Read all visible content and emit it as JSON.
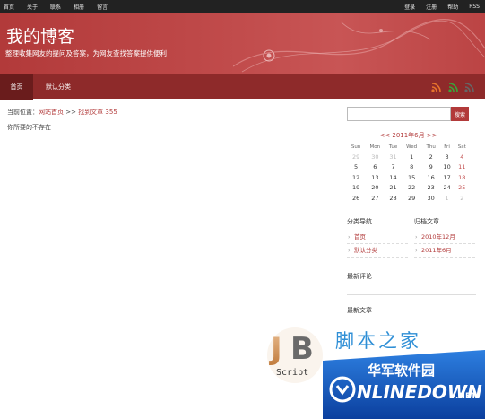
{
  "topbar": {
    "left_links": [
      "首页",
      "关于",
      "联系",
      "相册",
      "留言"
    ],
    "right_links": [
      "登录",
      "注册",
      "帮助",
      "RSS"
    ]
  },
  "header": {
    "title": "我的博客",
    "subtitle": "整理收集网友的提问及答案，为网友查找答案提供便利"
  },
  "nav": {
    "tabs": [
      {
        "label": "首页",
        "active": true
      },
      {
        "label": "默认分类",
        "active": false
      }
    ],
    "rss_colors": [
      "#e8742c",
      "#3aa53a",
      "#666666"
    ]
  },
  "main": {
    "breadcrumb_prefix": "当前位置：",
    "breadcrumb_home": "网站首页",
    "breadcrumb_sep": " >> ",
    "breadcrumb_current": "找到文章 355",
    "notfound": "你所要的不存在"
  },
  "sidebar": {
    "search_placeholder": "",
    "search_button": "搜索",
    "calendar": {
      "prev": "<<",
      "month": "2011年6月",
      "next": ">>",
      "weekdays": [
        "Sun",
        "Mon",
        "Tue",
        "Wed",
        "Thu",
        "Fri",
        "Sat"
      ],
      "weeks": [
        [
          "29",
          "30",
          "31",
          "1",
          "2",
          "3",
          "4"
        ],
        [
          "5",
          "6",
          "7",
          "8",
          "9",
          "10",
          "11"
        ],
        [
          "12",
          "13",
          "14",
          "15",
          "16",
          "17",
          "18"
        ],
        [
          "19",
          "20",
          "21",
          "22",
          "23",
          "24",
          "25"
        ],
        [
          "26",
          "27",
          "28",
          "29",
          "30",
          "1",
          "2"
        ]
      ]
    },
    "categories_title": "分类导航",
    "categories": [
      "首页",
      "默认分类"
    ],
    "archives_title": "归档文章",
    "archives": [
      "2010年12月",
      "2011年6月"
    ],
    "recent_comments_title": "最新评论",
    "recent_posts_title": "最新文章"
  },
  "watermarks": {
    "jb_label": "Script",
    "jb_site": "脚本之家",
    "onlinedown_cn": "华军软件园",
    "onlinedown_en": "NLINEDOWN",
    "onlinedown_suffix": ".NET"
  }
}
